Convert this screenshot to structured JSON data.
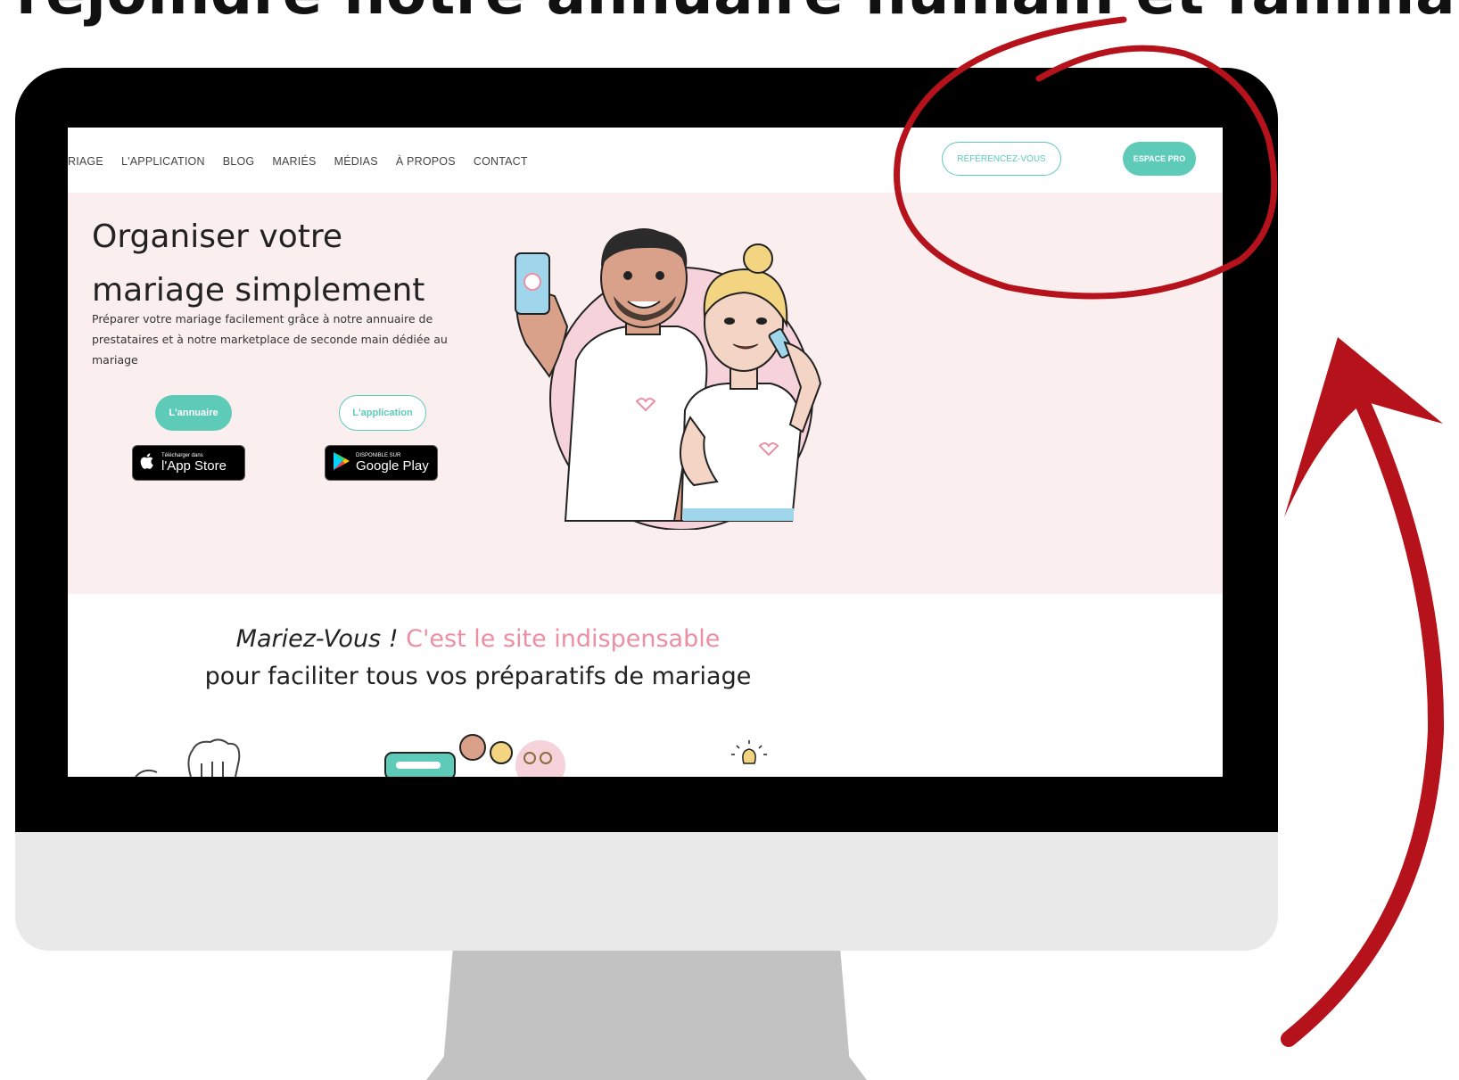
{
  "headline": "rejoindre notre annuaire humain et familial !",
  "nav": {
    "links": [
      "RIAGE",
      "L'APPLICATION",
      "BLOG",
      "MARIÉS",
      "MÉDIAS",
      "À PROPOS",
      "CONTACT"
    ],
    "referencez_label": "RÉFÉRENCEZ-VOUS",
    "espace_pro_label": "ESPACE PRO"
  },
  "hero": {
    "title_line1": "Organiser votre",
    "title_line2": "mariage simplement",
    "description": "Préparer votre mariage facilement grâce à notre annuaire de prestataires et à notre marketplace de seconde main dédiée au mariage",
    "btn_annuaire": "L'annuaire",
    "btn_application": "L'application",
    "appstore_small": "Télécharger dans",
    "appstore_big": "l'App Store",
    "googleplay_small": "DISPONIBLE SUR",
    "googleplay_big": "Google Play"
  },
  "section2": {
    "brand": "Mariez-Vous !",
    "highlight": "C'est le site indispensable",
    "line2": "pour faciliter tous vos préparatifs de mariage"
  },
  "colors": {
    "accent_teal": "#5ecbb8",
    "accent_pink": "#ec8fa2",
    "hero_bg": "#fbeeef",
    "annotation_red": "#b5121b"
  },
  "icons": [
    "apple-icon",
    "google-play-icon",
    "circle-annotation",
    "curved-arrow-annotation"
  ]
}
